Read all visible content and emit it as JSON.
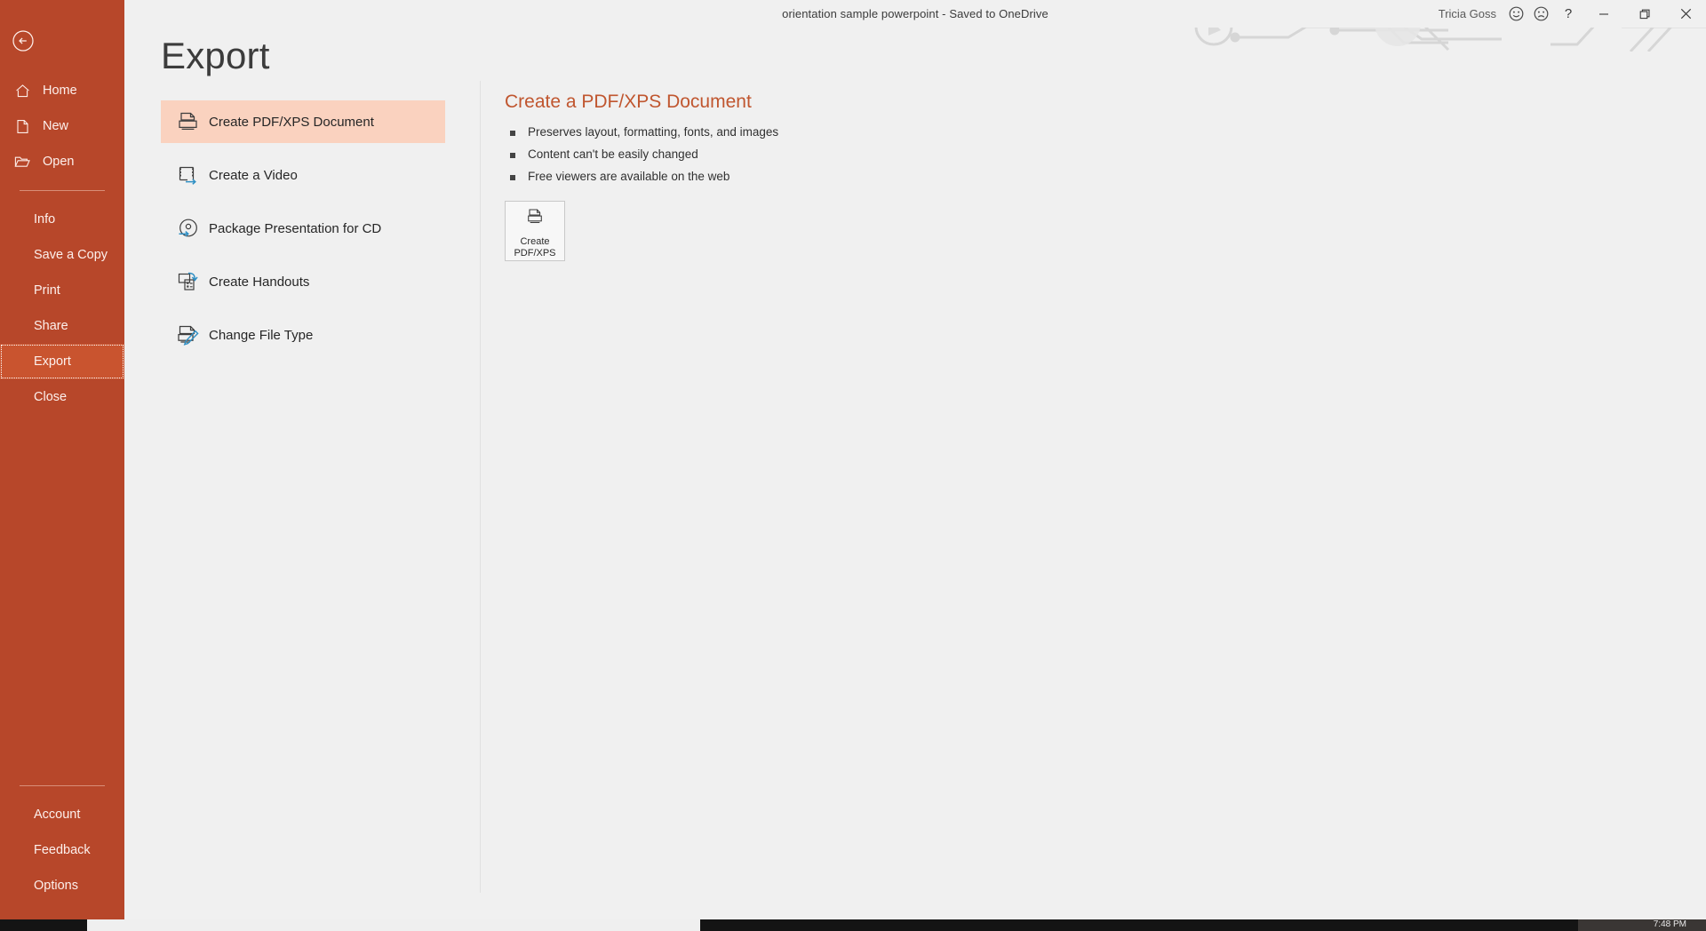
{
  "titlebar": {
    "document_title": "orientation sample powerpoint  -  Saved to OneDrive",
    "user_name": "Tricia Goss",
    "smiley_icon": "smiley-face-feedback-icon",
    "frown_icon": "frowning-face-feedback-icon",
    "help_label": "?",
    "minimize_label": "minimize",
    "restore_label": "restore",
    "close_label": "close"
  },
  "rail": {
    "back_label": "back-arrow",
    "top_items": [
      {
        "label": "Home",
        "icon": "home-icon"
      },
      {
        "label": "New",
        "icon": "new-document-icon"
      },
      {
        "label": "Open",
        "icon": "open-folder-icon"
      }
    ],
    "mid_items": [
      {
        "label": "Info",
        "selected": false
      },
      {
        "label": "Save a Copy",
        "selected": false
      },
      {
        "label": "Print",
        "selected": false
      },
      {
        "label": "Share",
        "selected": false
      },
      {
        "label": "Export",
        "selected": true
      },
      {
        "label": "Close",
        "selected": false
      }
    ],
    "bottom_items": [
      {
        "label": "Account"
      },
      {
        "label": "Feedback"
      },
      {
        "label": "Options"
      }
    ]
  },
  "page": {
    "title": "Export",
    "options": [
      {
        "label": "Create PDF/XPS Document",
        "icon": "pdf-document-icon",
        "selected": true
      },
      {
        "label": "Create a Video",
        "icon": "film-strip-icon",
        "selected": false
      },
      {
        "label": "Package Presentation for CD",
        "icon": "cd-disc-icon",
        "selected": false
      },
      {
        "label": "Create Handouts",
        "icon": "handouts-icon",
        "selected": false
      },
      {
        "label": "Change File Type",
        "icon": "file-pencil-icon",
        "selected": false
      }
    ],
    "detail": {
      "heading": "Create a PDF/XPS Document",
      "bullets": [
        "Preserves layout, formatting, fonts, and images",
        "Content can't be easily changed",
        "Free viewers are available on the web"
      ],
      "action_button": {
        "line1": "Create",
        "line2": "PDF/XPS",
        "icon": "pdf-document-icon"
      }
    }
  },
  "taskbar": {
    "time": "7:48 PM"
  },
  "colors": {
    "accent": "#b7472a",
    "selected_option_bg": "#fad2bf",
    "detail_heading": "#c0562f",
    "page_bg": "#f0f0f0"
  }
}
